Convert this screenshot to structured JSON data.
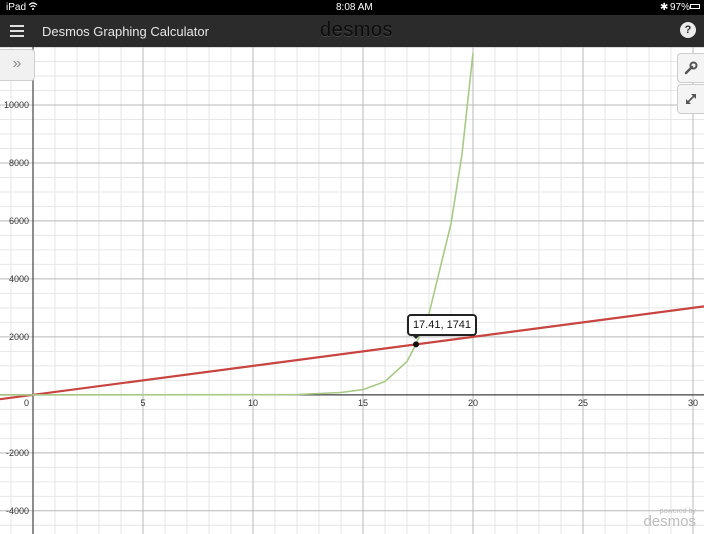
{
  "status_bar": {
    "device": "iPad",
    "time": "8:08 AM",
    "battery": "97%"
  },
  "header": {
    "title": "Desmos Graphing Calculator",
    "brand": "desmos",
    "help_label": "?"
  },
  "controls": {
    "expand_list_label": "»",
    "settings_icon": "wrench-icon",
    "zoom_icon": "diagonal-arrows-icon"
  },
  "point_tooltip": {
    "label": "17.41, 1741"
  },
  "watermark": {
    "powered": "powered by",
    "brand": "desmos"
  },
  "colors": {
    "line": "#c74440",
    "curve": "#a9c988",
    "header": "#2b2b2b"
  },
  "chart_data": {
    "type": "line",
    "x_range": [
      -1.5,
      30.5
    ],
    "y_range": [
      -4800,
      12000
    ],
    "x_major_ticks": [
      5,
      10,
      15,
      20,
      25,
      30
    ],
    "y_major_ticks": [
      -4000,
      -2000,
      2000,
      4000,
      6000,
      8000,
      10000
    ],
    "origin_label": "0",
    "grid": true,
    "series": [
      {
        "color": "#c74440",
        "points": [
          [
            -1.5,
            -150
          ],
          [
            30.5,
            3050
          ]
        ]
      },
      {
        "color": "#a9c988",
        "points": [
          [
            -1.5,
            0
          ],
          [
            12,
            10
          ],
          [
            14,
            80
          ],
          [
            15,
            180
          ],
          [
            16,
            460
          ],
          [
            17,
            1150
          ],
          [
            17.41,
            1741
          ],
          [
            18,
            2800
          ],
          [
            19,
            5900
          ],
          [
            19.5,
            8300
          ],
          [
            20,
            11800
          ]
        ]
      }
    ],
    "highlight_point": {
      "x": 17.41,
      "y": 1741
    }
  }
}
